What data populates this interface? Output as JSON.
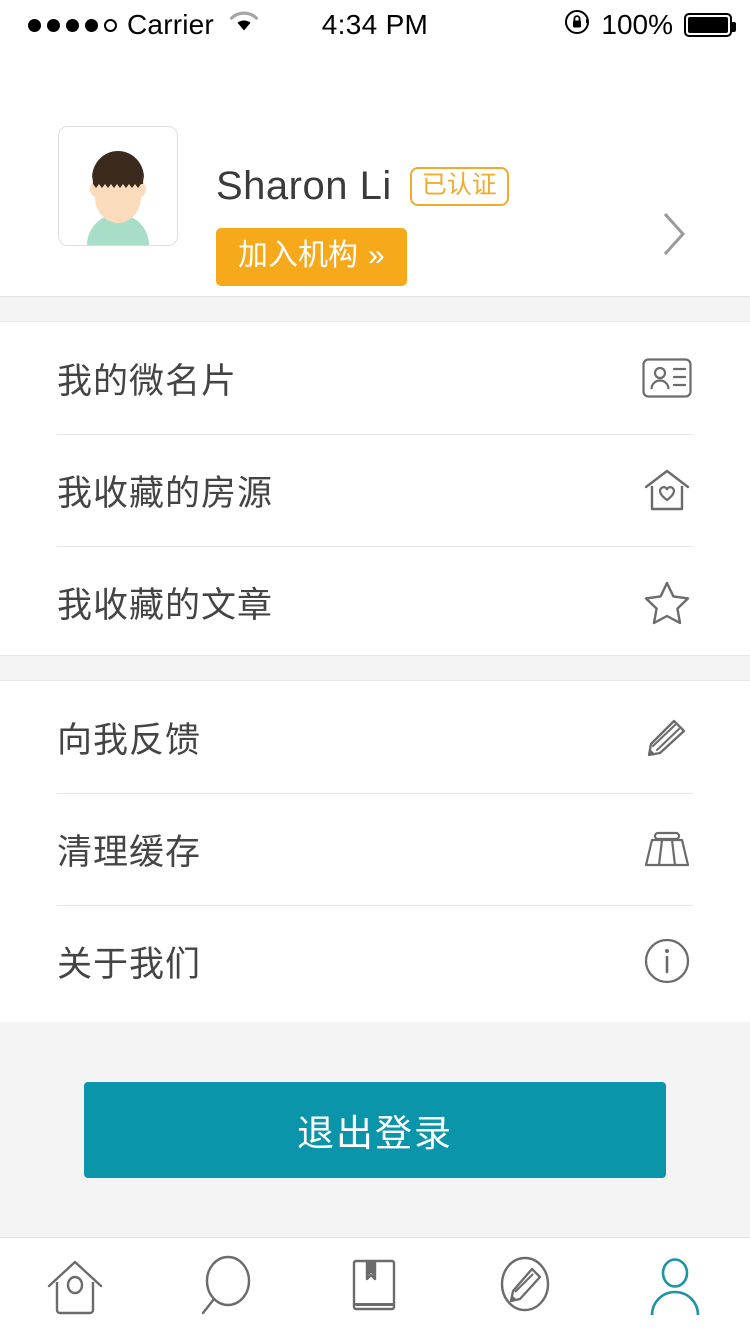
{
  "status_bar": {
    "signal_dots_filled": 4,
    "signal_dots_empty": 1,
    "carrier": "Carrier",
    "wifi_icon": "wifi-icon",
    "time": "4:34 PM",
    "lock_icon": "rotation-lock-icon",
    "battery_percent": "100%",
    "battery_icon": "battery-full-icon"
  },
  "profile": {
    "avatar_icon": "user-avatar",
    "name": "Sharon Li",
    "verified_badge": "已认证",
    "join_button": "加入机构",
    "join_button_chevron": "»",
    "detail_arrow_icon": "chevron-right-icon"
  },
  "menu_groups": [
    {
      "items": [
        {
          "label": "我的微名片",
          "icon": "id-card-icon"
        },
        {
          "label": "我收藏的房源",
          "icon": "house-heart-icon"
        },
        {
          "label": "我收藏的文章",
          "icon": "star-icon"
        }
      ]
    },
    {
      "items": [
        {
          "label": "向我反馈",
          "icon": "pencil-icon"
        },
        {
          "label": "清理缓存",
          "icon": "trash-can-icon"
        },
        {
          "label": "关于我们",
          "icon": "info-circle-icon"
        }
      ]
    }
  ],
  "logout": {
    "label": "退出登录"
  },
  "tabbar": {
    "items": [
      {
        "name": "home",
        "icon": "house-icon",
        "active": false
      },
      {
        "name": "search",
        "icon": "magnifier-icon",
        "active": false
      },
      {
        "name": "library",
        "icon": "book-icon",
        "active": false
      },
      {
        "name": "write",
        "icon": "pencil-circle-icon",
        "active": false
      },
      {
        "name": "profile",
        "icon": "person-icon",
        "active": true
      }
    ]
  },
  "colors": {
    "accent_teal": "#0b95aa",
    "accent_orange": "#f7a91c",
    "badge_orange": "#f0ab2d",
    "section_gray": "#f4f4f4",
    "icon_gray": "#6b6b6b",
    "text_dark": "#444444"
  }
}
